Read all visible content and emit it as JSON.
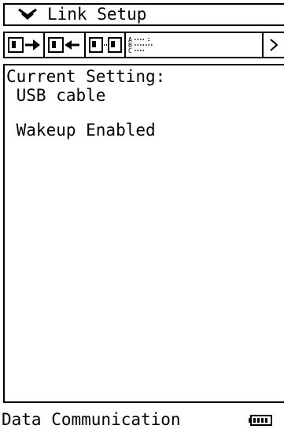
{
  "title_bar": {
    "menu_icon": "double-chevron-down-icon",
    "title": "Link Setup"
  },
  "toolbar": {
    "buttons": [
      {
        "name": "send",
        "icon": "send-arrow-icon"
      },
      {
        "name": "receive",
        "icon": "receive-arrow-icon"
      },
      {
        "name": "transfer",
        "icon": "transfer-icon"
      },
      {
        "name": "setup",
        "icon": "list-setup-icon"
      }
    ],
    "scroll_icon": "scroll-right-icon"
  },
  "content": {
    "heading": "Current Setting:",
    "connection": " USB cable",
    "wakeup": " Wakeup Enabled"
  },
  "status_bar": {
    "app_name": "Data Communication",
    "battery_icon": "battery-icon"
  }
}
